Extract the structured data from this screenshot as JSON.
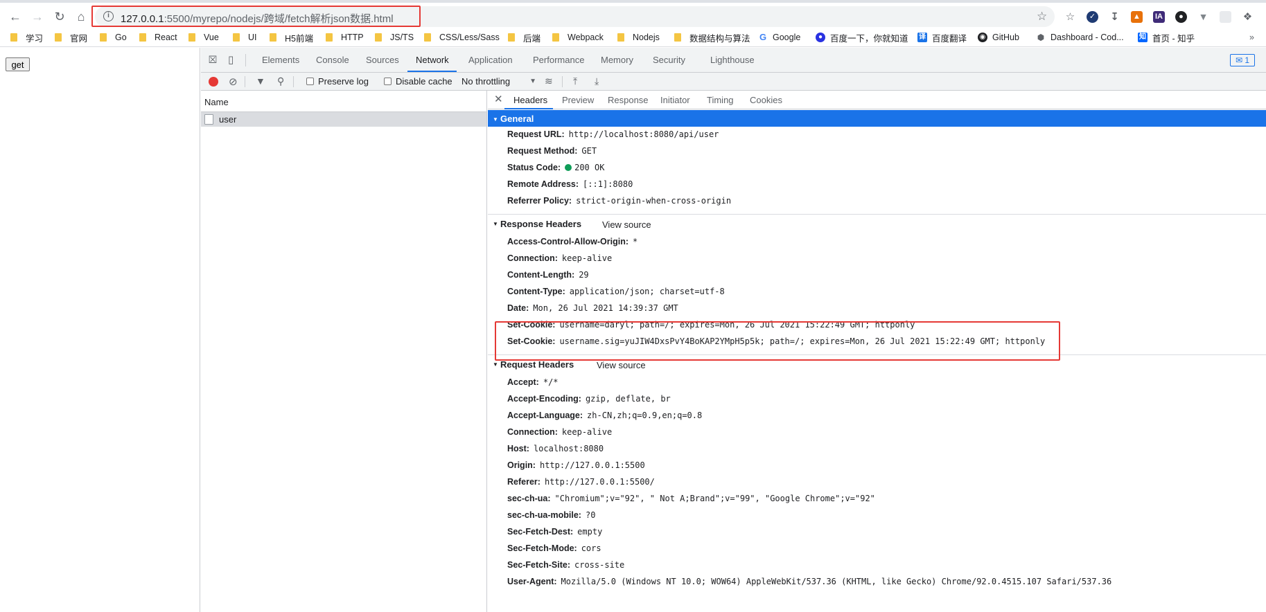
{
  "browser": {
    "url_host": "127.0.0.1",
    "url_rest": ":5500/myrepo/nodejs/跨域/fetch解析json数据.html"
  },
  "bookmarks": [
    {
      "label": "学习",
      "type": "folder"
    },
    {
      "label": "官网",
      "type": "folder"
    },
    {
      "label": "Go",
      "type": "folder"
    },
    {
      "label": "React",
      "type": "folder"
    },
    {
      "label": "Vue",
      "type": "folder"
    },
    {
      "label": "UI",
      "type": "folder"
    },
    {
      "label": "H5前端",
      "type": "folder"
    },
    {
      "label": "HTTP",
      "type": "folder"
    },
    {
      "label": "JS/TS",
      "type": "folder"
    },
    {
      "label": "CSS/Less/Sass",
      "type": "folder"
    },
    {
      "label": "后端",
      "type": "folder"
    },
    {
      "label": "Webpack",
      "type": "folder"
    },
    {
      "label": "Nodejs",
      "type": "folder"
    },
    {
      "label": "数据结构与算法",
      "type": "folder"
    },
    {
      "label": "Google",
      "type": "site"
    },
    {
      "label": "百度一下，你就知道",
      "type": "site"
    },
    {
      "label": "百度翻译",
      "type": "site"
    },
    {
      "label": "GitHub",
      "type": "site"
    },
    {
      "label": "Dashboard - Cod...",
      "type": "site"
    },
    {
      "label": "首页 - 知乎",
      "type": "site"
    }
  ],
  "page": {
    "get_button": "get"
  },
  "devtools": {
    "tabs": [
      "Elements",
      "Console",
      "Sources",
      "Network",
      "Application",
      "Performance",
      "Memory",
      "Security",
      "Lighthouse"
    ],
    "issues_count": "1",
    "toolbar": {
      "preserve_log": "Preserve log",
      "disable_cache": "Disable cache",
      "throttling": "No throttling"
    },
    "name_header": "Name",
    "request_name": "user",
    "detail_tabs": [
      "Headers",
      "Preview",
      "Response",
      "Initiator",
      "Timing",
      "Cookies"
    ],
    "general": {
      "title": "General",
      "rows": [
        {
          "k": "Request URL:",
          "v": "http://localhost:8080/api/user"
        },
        {
          "k": "Request Method:",
          "v": "GET"
        },
        {
          "k": "Status Code:",
          "v": "200 OK"
        },
        {
          "k": "Remote Address:",
          "v": "[::1]:8080"
        },
        {
          "k": "Referrer Policy:",
          "v": "strict-origin-when-cross-origin"
        }
      ]
    },
    "response_headers": {
      "title": "Response Headers",
      "view_source": "View source",
      "rows": [
        {
          "k": "Access-Control-Allow-Origin:",
          "v": "*"
        },
        {
          "k": "Connection:",
          "v": "keep-alive"
        },
        {
          "k": "Content-Length:",
          "v": "29"
        },
        {
          "k": "Content-Type:",
          "v": "application/json; charset=utf-8"
        },
        {
          "k": "Date:",
          "v": "Mon, 26 Jul 2021 14:39:37 GMT"
        },
        {
          "k": "Set-Cookie:",
          "v": "username=daryl; path=/; expires=Mon, 26 Jul 2021 15:22:49 GMT; httponly"
        },
        {
          "k": "Set-Cookie:",
          "v": "username.sig=yuJIW4DxsPvY4BoKAP2YMpH5p5k; path=/; expires=Mon, 26 Jul 2021 15:22:49 GMT; httponly"
        }
      ]
    },
    "request_headers": {
      "title": "Request Headers",
      "view_source": "View source",
      "rows": [
        {
          "k": "Accept:",
          "v": "*/*"
        },
        {
          "k": "Accept-Encoding:",
          "v": "gzip, deflate, br"
        },
        {
          "k": "Accept-Language:",
          "v": "zh-CN,zh;q=0.9,en;q=0.8"
        },
        {
          "k": "Connection:",
          "v": "keep-alive"
        },
        {
          "k": "Host:",
          "v": "localhost:8080"
        },
        {
          "k": "Origin:",
          "v": "http://127.0.0.1:5500"
        },
        {
          "k": "Referer:",
          "v": "http://127.0.0.1:5500/"
        },
        {
          "k": "sec-ch-ua:",
          "v": "\"Chromium\";v=\"92\", \" Not A;Brand\";v=\"99\", \"Google Chrome\";v=\"92\""
        },
        {
          "k": "sec-ch-ua-mobile:",
          "v": "?0"
        },
        {
          "k": "Sec-Fetch-Dest:",
          "v": "empty"
        },
        {
          "k": "Sec-Fetch-Mode:",
          "v": "cors"
        },
        {
          "k": "Sec-Fetch-Site:",
          "v": "cross-site"
        },
        {
          "k": "User-Agent:",
          "v": "Mozilla/5.0 (Windows NT 10.0; WOW64) AppleWebKit/537.36 (KHTML, like Gecko) Chrome/92.0.4515.107 Safari/537.36"
        }
      ]
    }
  },
  "colors": {
    "accent": "#1a73e8",
    "highlight": "#e53935",
    "status_ok": "#0f9d58"
  }
}
